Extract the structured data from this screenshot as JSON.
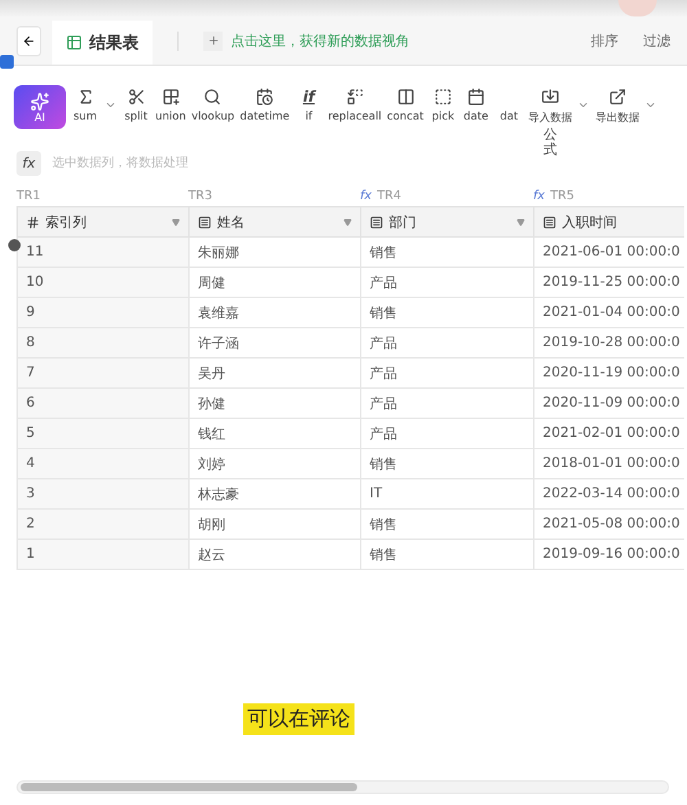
{
  "tabs": [
    {
      "label": "结果表",
      "selected": true
    }
  ],
  "add_view": {
    "label": "点击这里，获得新的数据视角"
  },
  "actions": [
    "排序",
    "过滤"
  ],
  "toolbar": [
    {
      "label": "sum",
      "caret": true
    },
    {
      "label": "split",
      "caret": false
    },
    {
      "label": "union",
      "caret": false
    },
    {
      "label": "vlookup",
      "caret": false
    },
    {
      "label": "datetime",
      "caret": false
    },
    {
      "label": "if",
      "glyph": "if",
      "caret": false
    },
    {
      "label": "replaceall",
      "caret": false
    },
    {
      "label": "concat",
      "caret": false
    },
    {
      "label": "pick",
      "caret": false
    },
    {
      "label": "date",
      "caret": false
    },
    {
      "label": "dat",
      "caret": false
    },
    {
      "label": "导入数据",
      "caret": true,
      "sub": "公式"
    },
    {
      "label": "导出数据",
      "caret": true
    }
  ],
  "ai_button": {
    "label": "AI"
  },
  "formula_bar": {
    "button": "fx",
    "placeholder": "选中数据列，将数据处理"
  },
  "table": {
    "columns": [
      {
        "group": "TR1",
        "name": "索引列",
        "kind": "number",
        "filter": true
      },
      {
        "group": "TR3",
        "name": "姓名",
        "kind": "text",
        "filter": true
      },
      {
        "group": "TR4",
        "fx": "fx",
        "name": "部门",
        "kind": "text",
        "filter": true
      },
      {
        "group": "TR5",
        "fx": "fx",
        "name": "入职时间",
        "kind": "text",
        "filter": false
      }
    ],
    "rows": [
      [
        "11",
        "朱丽娜",
        "销售",
        "2021-06-01 00:00:0"
      ],
      [
        "10",
        "周健",
        "产品",
        "2019-11-25 00:00:0"
      ],
      [
        "9",
        "袁维嘉",
        "销售",
        "2021-01-04 00:00:0"
      ],
      [
        "8",
        "许子涵",
        "产品",
        "2019-10-28 00:00:0"
      ],
      [
        "7",
        "吴丹",
        "产品",
        "2020-11-19 00:00:0"
      ],
      [
        "6",
        "孙健",
        "产品",
        "2020-11-09 00:00:0"
      ],
      [
        "5",
        "钱红",
        "产品",
        "2021-02-01 00:00:0"
      ],
      [
        "4",
        "刘婷",
        "销售",
        "2018-01-01 00:00:0"
      ],
      [
        "3",
        "林志豪",
        "IT",
        "2022-03-14 00:00:0"
      ],
      [
        "2",
        "胡刚",
        "销售",
        "2021-05-08 00:00:0"
      ],
      [
        "1",
        "赵云",
        "销售",
        "2019-09-16 00:00:0"
      ]
    ]
  },
  "caption": "可以在评论"
}
